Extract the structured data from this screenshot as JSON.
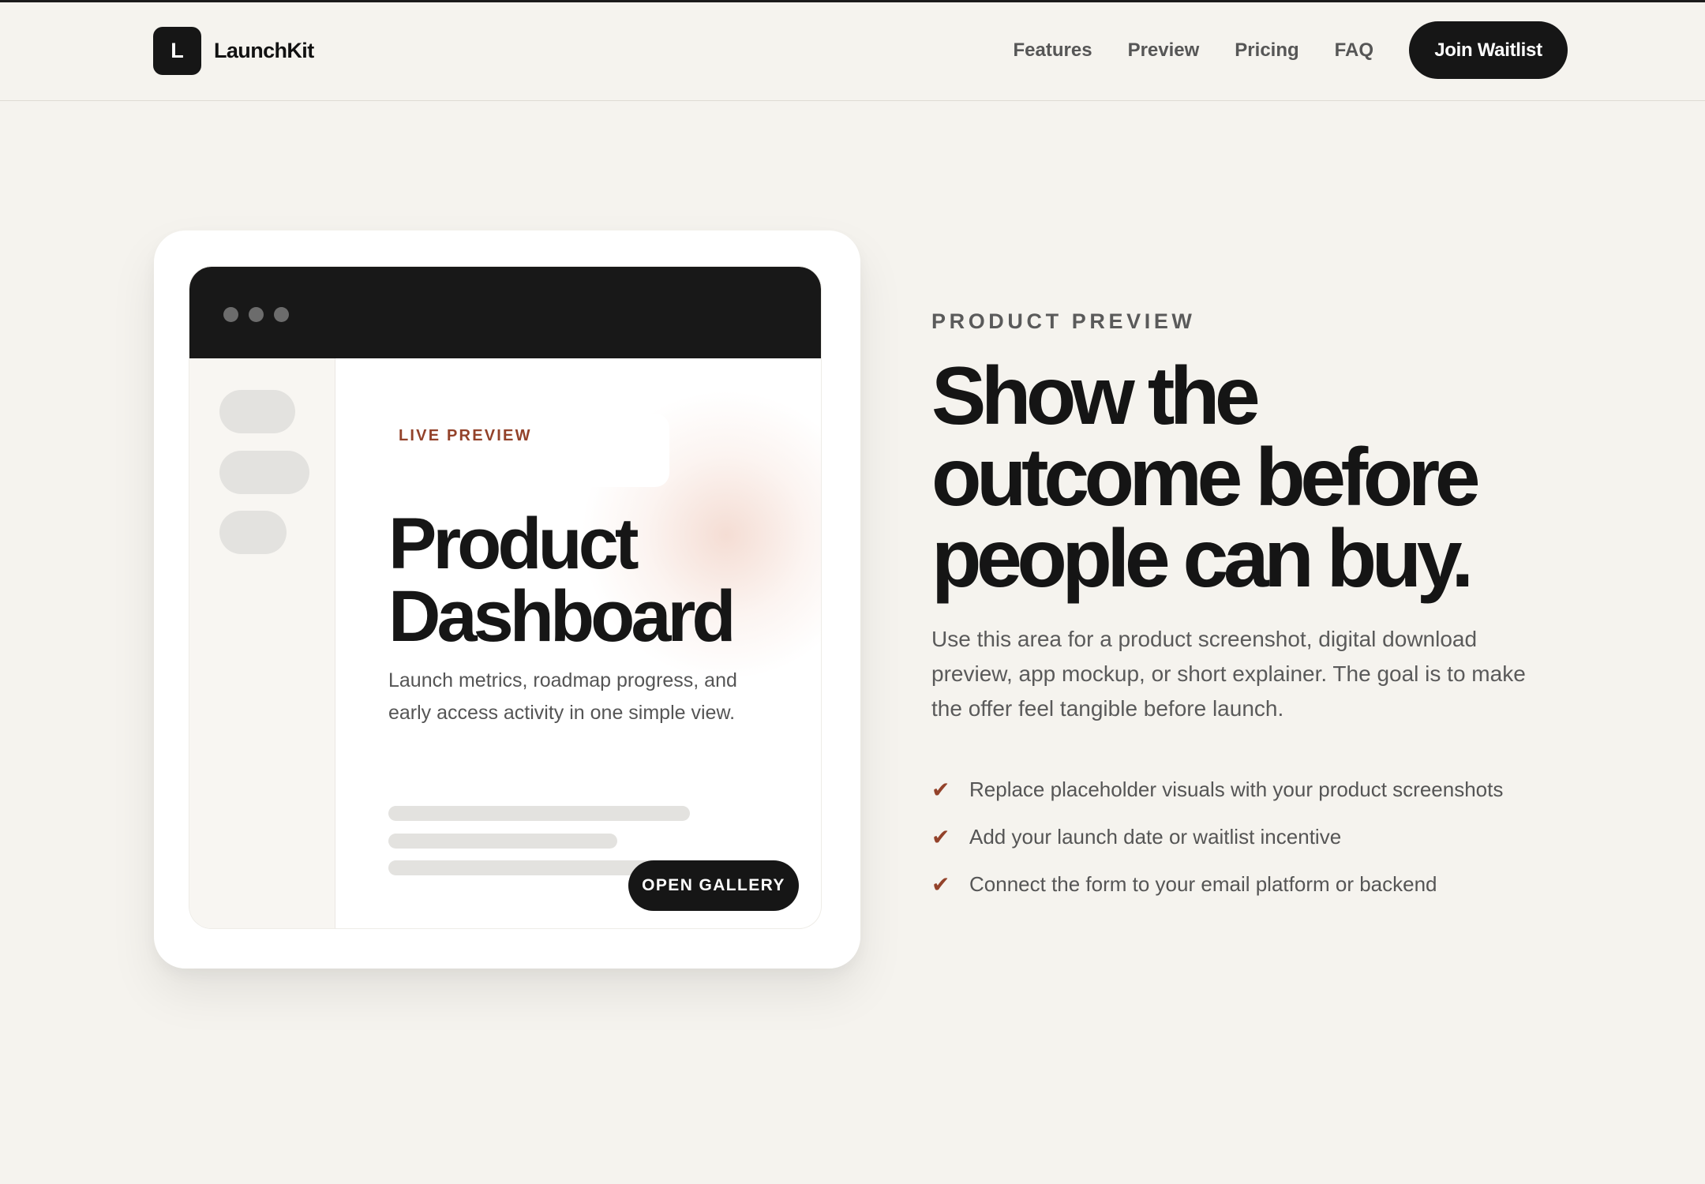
{
  "brand": {
    "mark": "L",
    "name": "LaunchKit"
  },
  "nav": {
    "links": [
      "Features",
      "Preview",
      "Pricing",
      "FAQ"
    ],
    "cta": "Join Waitlist"
  },
  "preview_card": {
    "chip_label": "LIVE PREVIEW",
    "title": "Product Dashboard",
    "description": "Launch metrics, roadmap progress, and early access activity in one simple view.",
    "button": "OPEN GALLERY"
  },
  "section": {
    "eyebrow": "PRODUCT PREVIEW",
    "headline": "Show the outcome before people can buy.",
    "lead": "Use this area for a product screenshot, digital download preview, app mockup, or short explainer. The goal is to make the offer feel tangible before launch.",
    "checks": [
      "Replace placeholder visuals with your product screenshots",
      "Add your launch date or waitlist incentive",
      "Connect the form to your email platform or backend"
    ]
  },
  "icons": {
    "check": "check-icon",
    "window_controls": "window-dot-icon"
  },
  "colors": {
    "accent": "#93422a",
    "dark": "#161616",
    "background": "#f5f3ee"
  }
}
